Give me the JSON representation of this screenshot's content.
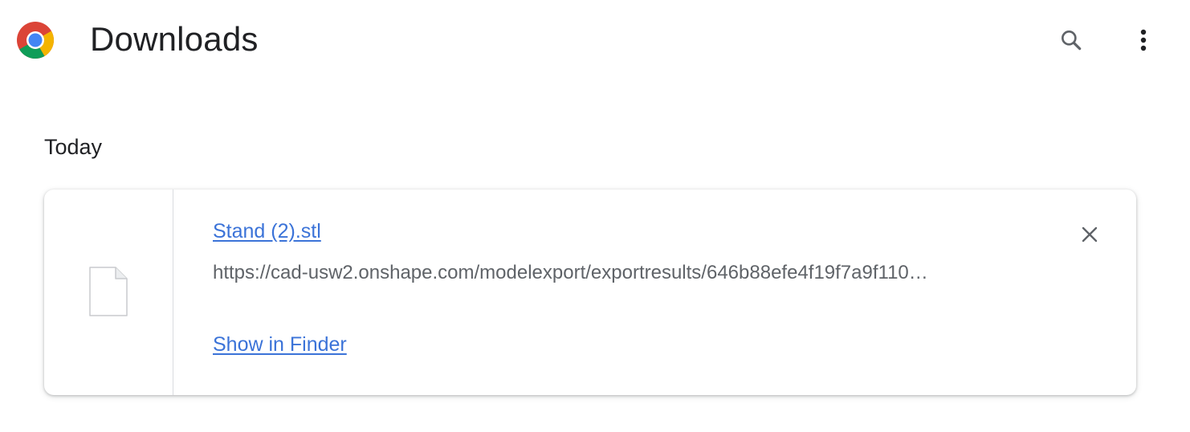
{
  "header": {
    "title": "Downloads",
    "logo_icon": "chrome-logo-icon",
    "search_icon": "search-icon",
    "menu_icon": "more-vert-icon"
  },
  "sections": [
    {
      "label": "Today",
      "items": [
        {
          "file_name": "Stand (2).stl",
          "url": "https://cad-usw2.onshape.com/modelexport/exportresults/646b88efe4f19f7a9f110…",
          "action_label": "Show in Finder",
          "file_icon": "file-icon",
          "remove_icon": "close-icon"
        }
      ]
    }
  ],
  "colors": {
    "link": "#3b73d8",
    "text_primary": "#202124",
    "text_secondary": "#5f6368",
    "divider": "#dadce0"
  }
}
